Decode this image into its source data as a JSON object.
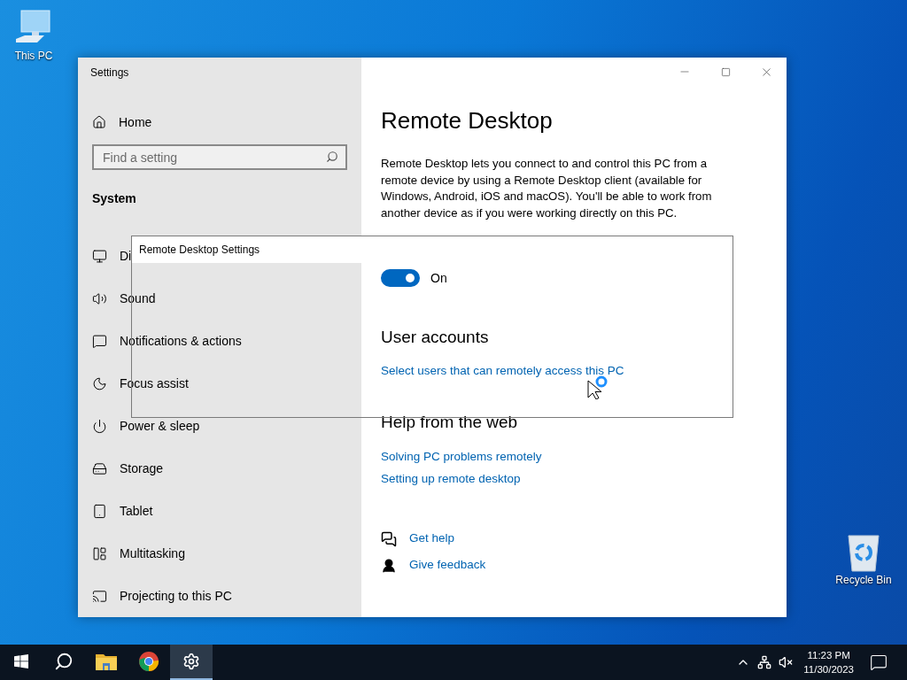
{
  "desktop_icons": [
    {
      "label": "This PC"
    },
    {
      "label": "Recycle Bin"
    }
  ],
  "window": {
    "title": "Settings"
  },
  "sidebar": {
    "home": "Home",
    "search": {
      "placeholder": "Find a setting"
    },
    "section": "System",
    "items": [
      {
        "label": "Di"
      },
      {
        "label": "Sound"
      },
      {
        "label": "Notifications & actions"
      },
      {
        "label": "Focus assist"
      },
      {
        "label": "Power & sleep"
      },
      {
        "label": "Storage"
      },
      {
        "label": "Tablet"
      },
      {
        "label": "Multitasking"
      },
      {
        "label": "Projecting to this PC"
      }
    ]
  },
  "content": {
    "title": "Remote Desktop",
    "description": "Remote Desktop lets you connect to and control this PC from a remote device by using a Remote Desktop client (available for Windows, Android, iOS and macOS). You'll be able to work from another device as if you were working directly on this PC.",
    "toggle": {
      "on": true,
      "label": "On"
    },
    "user_accounts": {
      "heading": "User accounts",
      "link": "Select users that can remotely access this PC"
    },
    "help": {
      "heading": "Help from the web",
      "links": [
        "Solving PC problems remotely",
        "Setting up remote desktop"
      ]
    },
    "actions": [
      "Get help",
      "Give feedback"
    ]
  },
  "dialog": {
    "title": "Remote Desktop Settings"
  },
  "taskbar": {
    "apps": [
      {
        "kind": "start",
        "selected": false
      },
      {
        "kind": "search",
        "selected": false
      },
      {
        "kind": "files",
        "selected": false
      },
      {
        "kind": "browser",
        "selected": false
      },
      {
        "kind": "settings",
        "selected": true
      }
    ],
    "time": "11:23 PM",
    "date": "11/30/2023"
  }
}
